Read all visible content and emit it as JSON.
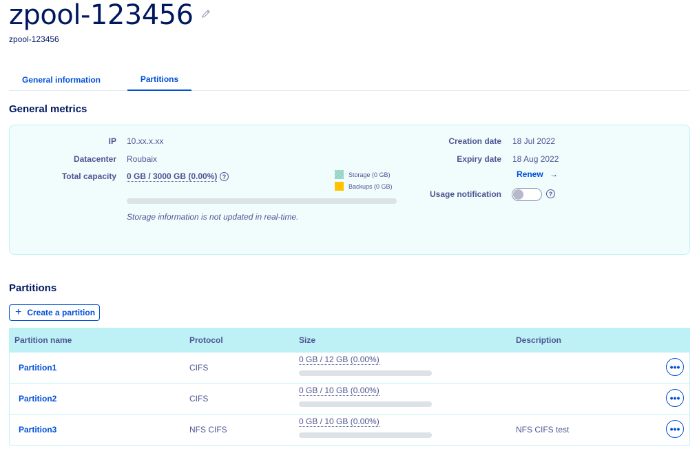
{
  "header": {
    "title": "zpool-123456",
    "subtitle": "zpool-123456"
  },
  "tabs": [
    {
      "label": "General information",
      "active": false
    },
    {
      "label": "Partitions",
      "active": true
    }
  ],
  "metrics": {
    "heading": "General metrics",
    "ip_label": "IP",
    "ip_value": "10.xx.x.xx",
    "datacenter_label": "Datacenter",
    "datacenter_value": "Roubaix",
    "capacity_label": "Total capacity",
    "capacity_value": "0 GB / 3000 GB (0.00%)",
    "capacity_used_percent": 0,
    "legend_storage": "Storage (0 GB)",
    "legend_backups": "Backups (0 GB)",
    "note": "Storage information is not updated in real-time.",
    "creation_label": "Creation date",
    "creation_value": "18 Jul 2022",
    "expiry_label": "Expiry date",
    "expiry_value": "18 Aug 2022",
    "renew_label": "Renew",
    "usage_label": "Usage notification",
    "usage_enabled": false,
    "colors": {
      "storage": "#8fd3c4",
      "backups": "#ffc300"
    }
  },
  "partitions": {
    "heading": "Partitions",
    "create_label": "Create a partition",
    "columns": [
      "Partition name",
      "Protocol",
      "Size",
      "Description"
    ],
    "rows": [
      {
        "name": "Partition1",
        "protocol": "CIFS",
        "size": "0 GB / 12 GB (0.00%)",
        "used_percent": 0,
        "description": ""
      },
      {
        "name": "Partition2",
        "protocol": "CIFS",
        "size": "0 GB / 10 GB (0.00%)",
        "used_percent": 0,
        "description": ""
      },
      {
        "name": "Partition3",
        "protocol": "NFS CIFS",
        "size": "0 GB / 10 GB (0.00%)",
        "used_percent": 0,
        "description": "NFS CIFS test"
      }
    ]
  }
}
